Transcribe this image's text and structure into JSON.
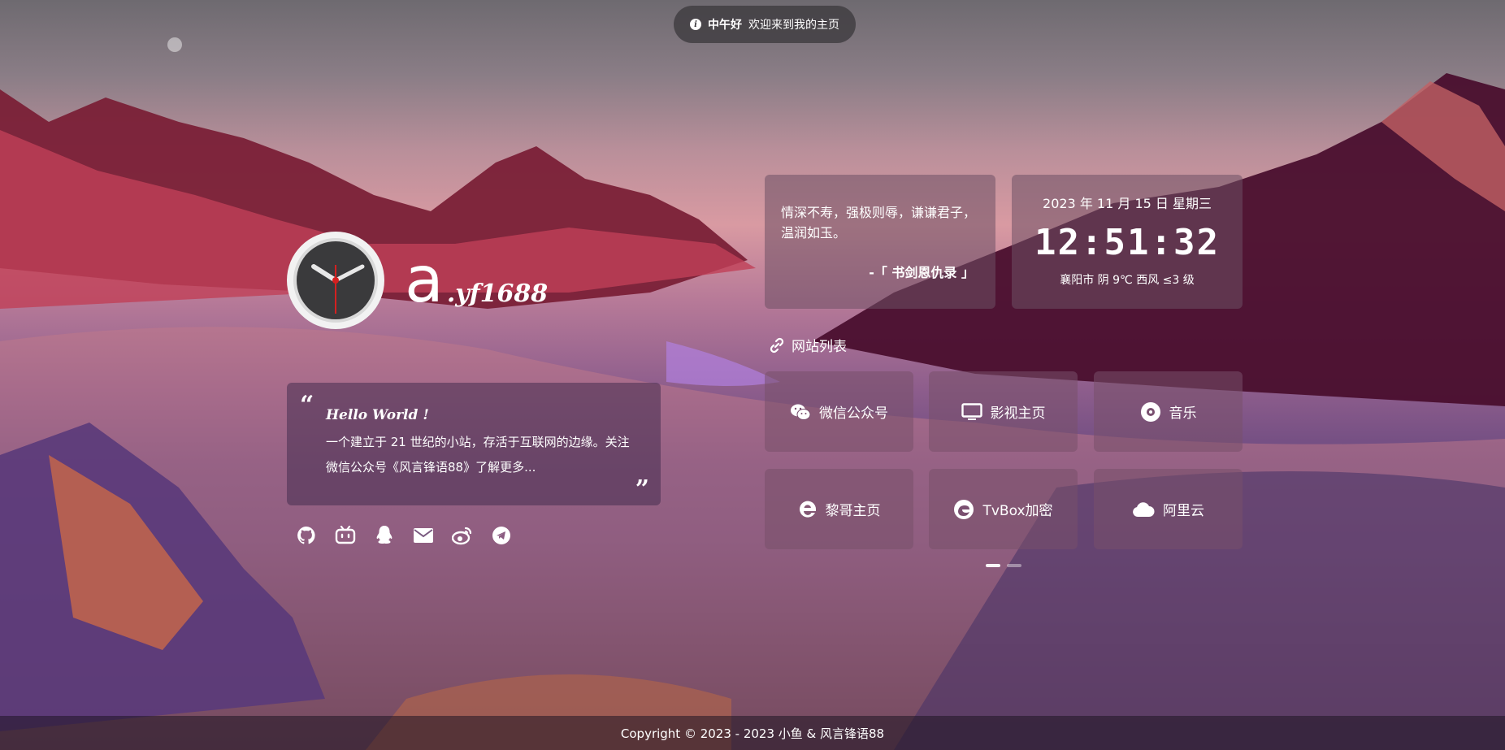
{
  "toast": {
    "greeting": "中午好",
    "message": "欢迎来到我的主页"
  },
  "brand": {
    "main": "a",
    "suffix": ".yf1688"
  },
  "intro": {
    "hello": "Hello World !",
    "description": "一个建立于 21 世纪的小站，存活于互联网的边缘。关注微信公众号《风言锋语88》了解更多..."
  },
  "socials": [
    {
      "name": "github-icon"
    },
    {
      "name": "bilibili-icon"
    },
    {
      "name": "qq-icon"
    },
    {
      "name": "mail-icon"
    },
    {
      "name": "weibo-icon"
    },
    {
      "name": "telegram-icon"
    }
  ],
  "quote": {
    "text": "情深不寿，强极则辱，谦谦君子，温润如玉。",
    "source": "-「 书剑恩仇录 」"
  },
  "datetime": {
    "date": "2023 年 11 月 15 日 星期三",
    "time": "12:51:32",
    "weather": "襄阳市 阴 9℃ 西风 ≤3 级"
  },
  "site_list": {
    "title": "网站列表",
    "items": [
      {
        "label": "微信公众号",
        "icon": "wechat-icon"
      },
      {
        "label": "影视主页",
        "icon": "monitor-icon"
      },
      {
        "label": "音乐",
        "icon": "music-disc-icon"
      },
      {
        "label": "黎哥主页",
        "icon": "edge-icon"
      },
      {
        "label": "TvBox加密",
        "icon": "edge-icon"
      },
      {
        "label": "阿里云",
        "icon": "cloud-icon"
      }
    ]
  },
  "footer": {
    "copyright": "Copyright © 2023 - 2023 小鱼 & 风言锋语88"
  }
}
